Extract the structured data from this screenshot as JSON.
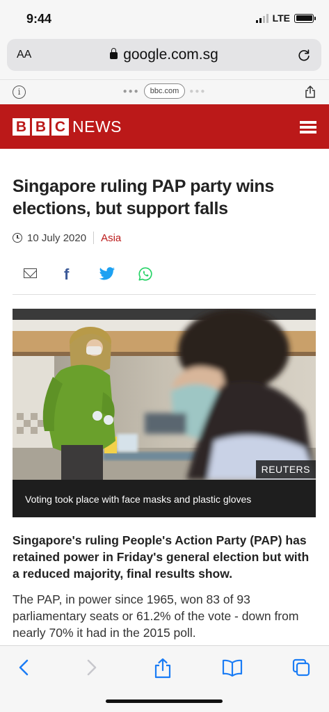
{
  "status": {
    "time": "9:44",
    "network": "LTE"
  },
  "browser": {
    "text_size": "AA",
    "url": "google.com.sg",
    "amp_domain": "bbc.com"
  },
  "header": {
    "logo_letters": [
      "B",
      "B",
      "C"
    ],
    "news_word": "NEWS"
  },
  "article": {
    "headline": "Singapore ruling PAP party wins elections, but support falls",
    "date": "10 July 2020",
    "section": "Asia",
    "image_credit": "REUTERS",
    "image_caption": "Voting took place with face masks and plastic gloves",
    "intro": "Singapore's ruling People's Action Party (PAP) has retained power in Friday's general election but with a reduced majority, final results show.",
    "body": "The PAP, in power since 1965, won 83 of 93 parliamentary seats or 61.2% of the vote - down from nearly 70% it had in the 2015 poll."
  },
  "share": [
    "email-icon",
    "facebook-icon",
    "twitter-icon",
    "whatsapp-icon"
  ],
  "toolbar": [
    "back-icon",
    "forward-icon",
    "share-icon",
    "bookmarks-icon",
    "tabs-icon"
  ],
  "colors": {
    "bbc_red": "#bb1919",
    "ios_blue": "#1a7cf5",
    "facebook": "#3b5998",
    "twitter": "#1da1f2",
    "whatsapp": "#25d366"
  }
}
